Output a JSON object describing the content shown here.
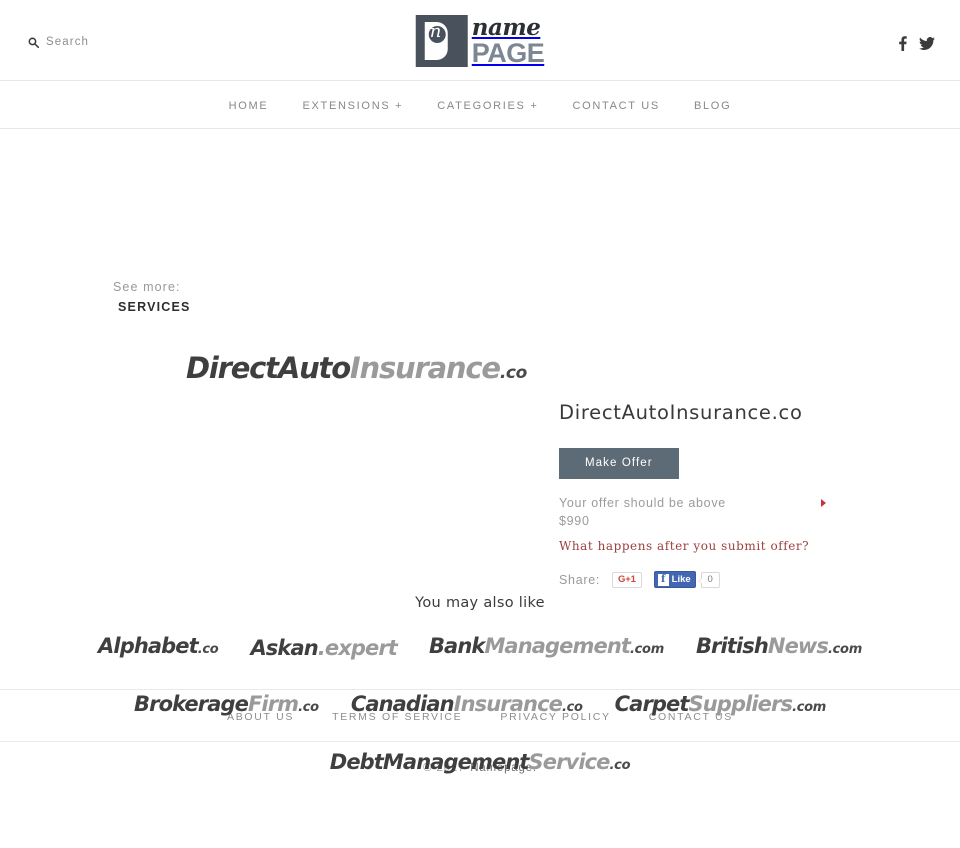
{
  "header": {
    "search": {
      "label": "Search",
      "icon": "search-icon"
    },
    "logo": {
      "mark_letter": "n",
      "script_word": "name",
      "bold_word": "PAGE"
    },
    "social": [
      {
        "name": "facebook-icon",
        "label": "f"
      },
      {
        "name": "twitter-icon",
        "label": "t"
      }
    ]
  },
  "nav": {
    "items": [
      {
        "label": "HOME"
      },
      {
        "label": "EXTENSIONS +"
      },
      {
        "label": "CATEGORIES +"
      },
      {
        "label": "CONTACT US"
      },
      {
        "label": "BLOG"
      }
    ]
  },
  "see_more": {
    "label": "See more:",
    "category": "SERVICES"
  },
  "hero": {
    "parts": [
      {
        "text": "Direct",
        "tone": "dark"
      },
      {
        "text": "Auto",
        "tone": "dark"
      },
      {
        "text": "Insurance",
        "tone": "light"
      },
      {
        "text": ".co",
        "tone": "tld"
      }
    ]
  },
  "detail": {
    "domain_title": "DirectAutoInsurance.co",
    "make_offer_label": "Make Offer",
    "offer_note_line1": "Your offer should be above",
    "offer_note_line2": "$990",
    "what_happens_label": "What happens after you submit offer?",
    "share_label": "Share:",
    "gplus_label": "G+1",
    "fb_icon_letter": "f",
    "fb_like_label": "Like",
    "fb_count": "0"
  },
  "also_like": {
    "title": "You may also like",
    "items": [
      {
        "parts": [
          {
            "text": "Alphabet",
            "tone": "dark"
          },
          {
            "text": ".co",
            "tone": "tld"
          }
        ]
      },
      {
        "parts": [
          {
            "text": "Askan",
            "tone": "dark"
          },
          {
            "text": ".expert",
            "tone": "light"
          }
        ]
      },
      {
        "parts": [
          {
            "text": "Bank",
            "tone": "dark"
          },
          {
            "text": "Management",
            "tone": "light"
          },
          {
            "text": ".com",
            "tone": "tld"
          }
        ]
      },
      {
        "parts": [
          {
            "text": "British",
            "tone": "dark"
          },
          {
            "text": "News",
            "tone": "light"
          },
          {
            "text": ".com",
            "tone": "tld"
          }
        ]
      },
      {
        "parts": [
          {
            "text": "Brokerage",
            "tone": "dark"
          },
          {
            "text": "Firm",
            "tone": "light"
          },
          {
            "text": ".co",
            "tone": "tld"
          }
        ]
      },
      {
        "parts": [
          {
            "text": "Canadian",
            "tone": "dark"
          },
          {
            "text": "Insurance",
            "tone": "light"
          },
          {
            "text": ".co",
            "tone": "tld"
          }
        ]
      },
      {
        "parts": [
          {
            "text": "Carpet",
            "tone": "dark"
          },
          {
            "text": "Suppliers",
            "tone": "light"
          },
          {
            "text": ".com",
            "tone": "tld"
          }
        ]
      },
      {
        "parts": [
          {
            "text": "DebtManagement",
            "tone": "dark"
          },
          {
            "text": "Service",
            "tone": "light"
          },
          {
            "text": ".co",
            "tone": "tld"
          }
        ]
      }
    ]
  },
  "footer": {
    "links": [
      {
        "label": "ABOUT US"
      },
      {
        "label": "TERMS OF SERVICE"
      },
      {
        "label": "PRIVACY POLICY"
      },
      {
        "label": "CONTACT US"
      }
    ],
    "copyright_year": "© 2017",
    "copyright_name": "Namepage."
  },
  "colors": {
    "button": "#5d6b77",
    "accent_red": "#9d3f3f",
    "marker_red": "#c7333d",
    "facebook_blue": "#4267b2",
    "gplus_red": "#d34836",
    "logo_dark": "#49525c"
  }
}
